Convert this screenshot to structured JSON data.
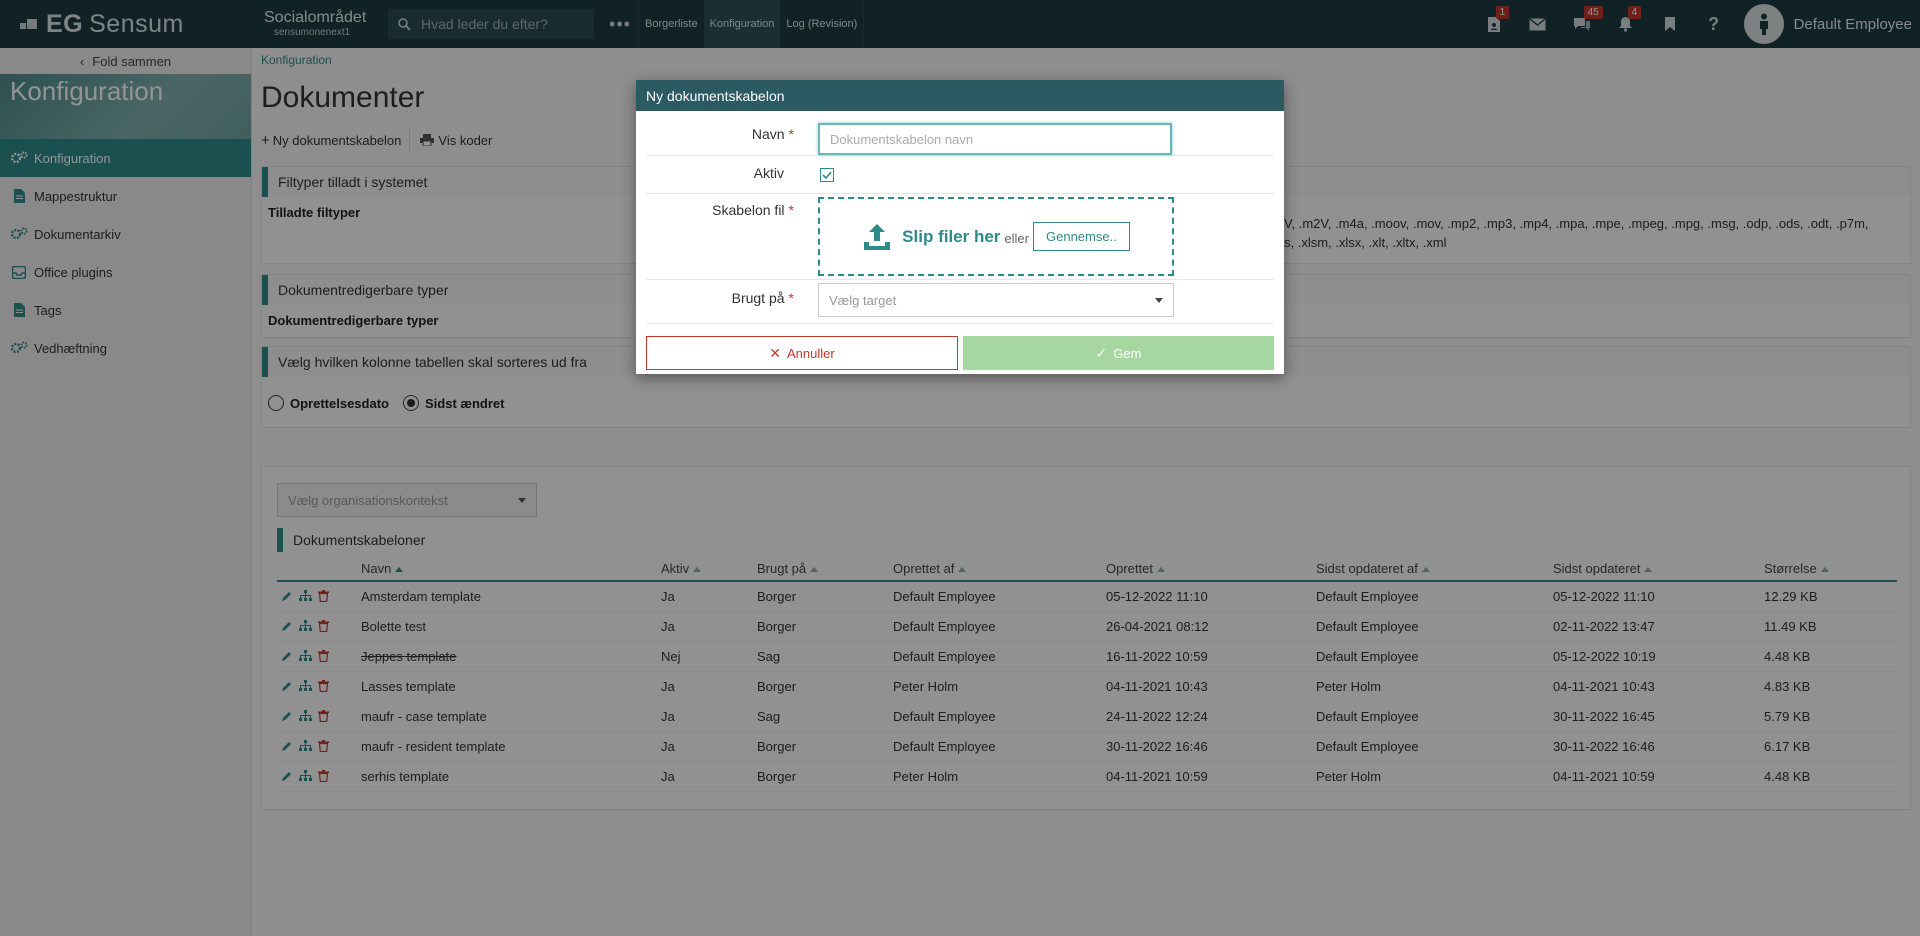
{
  "app": {
    "logo_brand": "EG",
    "logo_name": "Sensum",
    "org_title": "Socialområdet",
    "org_sub": "sensumonenext1",
    "search_placeholder": "Hvad leder du efter?",
    "more": "•••"
  },
  "nav": [
    "Borgerliste",
    "Konfiguration",
    "Log (Revision)"
  ],
  "top_badges": {
    "tasks": "1",
    "messages_chat": "45",
    "notifications": "4"
  },
  "user": {
    "name": "Default Employee"
  },
  "sidebar": {
    "fold_label": "Fold sammen",
    "banner": "Konfiguration",
    "items": [
      {
        "label": "Konfiguration",
        "icon": "gears-icon",
        "active": true
      },
      {
        "label": "Mappestruktur",
        "icon": "file-icon"
      },
      {
        "label": "Dokumentarkiv",
        "icon": "gears-icon"
      },
      {
        "label": "Office plugins",
        "icon": "inbox-icon"
      },
      {
        "label": "Tags",
        "icon": "file-icon"
      },
      {
        "label": "Vedhæftning",
        "icon": "gears-icon"
      }
    ]
  },
  "main": {
    "breadcrumb": "Konfiguration",
    "title": "Dokumenter",
    "btn_new": "Ny dokumentskabelon",
    "btn_codes": "Vis koder",
    "sec1_title": "Filtyper tilladt i systemet",
    "sec1_label": "Tilladte filtyper",
    "sec1_values_line1": "V, .m2V, .m4a, .moov, .mov, .mp2, .mp3, .mp4, .mpa, .mpe, .mpeg, .mpg, .msg, .odp, .ods, .odt, .p7m,",
    "sec1_values_line2": "s, .xlsm, .xlsx, .xlt, .xltx, .xml",
    "sec2_title": "Dokumentredigerbare typer",
    "sec2_label": "Dokumentredigerbare typer",
    "sec3_title": "Vælg hvilken kolonne tabellen skal sorteres ud fra",
    "radio1": "Oprettelsesdato",
    "radio2": "Sidst ændret",
    "org_placeholder": "Vælg organisationskontekst",
    "table_title": "Dokumentskabeloner",
    "columns": [
      "Navn",
      "Aktiv",
      "Brugt på",
      "Oprettet af",
      "Oprettet",
      "Sidst opdateret af",
      "Sidst opdateret",
      "Størrelse"
    ],
    "rows": [
      [
        "Amsterdam template",
        "Ja",
        "Borger",
        "Default Employee",
        "05-12-2022 11:10",
        "Default Employee",
        "05-12-2022 11:10",
        "12.29 KB"
      ],
      [
        "Bolette test",
        "Ja",
        "Borger",
        "Default Employee",
        "26-04-2021 08:12",
        "Default Employee",
        "02-11-2022 13:47",
        "11.49 KB"
      ],
      [
        "Jeppes template",
        "Nej",
        "Sag",
        "Default Employee",
        "16-11-2022 10:59",
        "Default Employee",
        "05-12-2022 10:19",
        "4.48 KB"
      ],
      [
        "Lasses template",
        "Ja",
        "Borger",
        "Peter Holm",
        "04-11-2021 10:43",
        "Peter Holm",
        "04-11-2021 10:43",
        "4.83 KB"
      ],
      [
        "maufr - case template",
        "Ja",
        "Sag",
        "Default Employee",
        "24-11-2022 12:24",
        "Default Employee",
        "30-11-2022 16:45",
        "5.79 KB"
      ],
      [
        "maufr - resident template",
        "Ja",
        "Borger",
        "Default Employee",
        "30-11-2022 16:46",
        "Default Employee",
        "30-11-2022 16:46",
        "6.17 KB"
      ],
      [
        "serhis template",
        "Ja",
        "Borger",
        "Peter Holm",
        "04-11-2021 10:59",
        "Peter Holm",
        "04-11-2021 10:59",
        "4.48 KB"
      ]
    ]
  },
  "modal": {
    "title": "Ny dokumentskabelon",
    "name_label": "Navn",
    "name_placeholder": "Dokumentskabelon navn",
    "active_label": "Aktiv",
    "file_label": "Skabelon fil",
    "drop_text": "Slip filer her",
    "or_text": "eller",
    "browse": "Gennemse..",
    "used_label": "Brugt på",
    "used_placeholder": "Vælg target",
    "cancel": "Annuller",
    "save": "Gem"
  },
  "colors": {
    "accent": "#2f8a8a",
    "topbar": "#1e3b44",
    "modal_header": "#2b5a62",
    "danger": "#c0392b",
    "save_disabled": "#a7d7a0"
  }
}
